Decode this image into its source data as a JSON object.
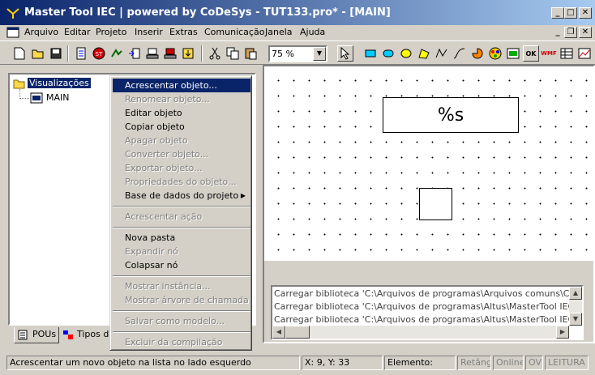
{
  "window": {
    "title": "Master Tool IEC | powered by CoDeSys - TUT133.pro* - [MAIN]",
    "minimize": "_",
    "maximize": "□",
    "close": "✕"
  },
  "menubar": {
    "items": [
      "Arquivo",
      "Editar",
      "Projeto",
      "Inserir",
      "Extras",
      "Comunicação",
      "Janela",
      "Ajuda"
    ],
    "mdi_min": "_",
    "mdi_restore": "❐",
    "mdi_close": "✕"
  },
  "toolbar": {
    "zoom_value": "75 %",
    "ok_label": "OK",
    "wmf_label": "WMF"
  },
  "tree": {
    "root_label": "Visualizações",
    "child_label": "MAIN"
  },
  "tabs": {
    "pous": "POUs",
    "tipos": "Tipos de"
  },
  "canvas": {
    "text_element": "%s"
  },
  "context_menu": {
    "items": [
      {
        "label": "Acrescentar objeto...",
        "state": "selected"
      },
      {
        "label": "Renomear objeto...",
        "state": "disabled"
      },
      {
        "label": "Editar objeto",
        "state": "enabled"
      },
      {
        "label": "Copiar objeto",
        "state": "enabled"
      },
      {
        "label": "Apagar objeto",
        "state": "disabled"
      },
      {
        "label": "Converter objeto...",
        "state": "disabled"
      },
      {
        "label": "Exportar objeto...",
        "state": "disabled"
      },
      {
        "label": "Propriedades do objeto...",
        "state": "disabled"
      },
      {
        "label": "Base de dados do projeto",
        "state": "enabled",
        "submenu": true
      },
      {
        "label": "Acrescentar ação",
        "state": "disabled"
      },
      {
        "label": "Nova pasta",
        "state": "enabled"
      },
      {
        "label": "Expandir nó",
        "state": "disabled"
      },
      {
        "label": "Colapsar nó",
        "state": "enabled"
      },
      {
        "label": "Mostrar instância...",
        "state": "disabled"
      },
      {
        "label": "Mostrar árvore de chamada",
        "state": "disabled"
      },
      {
        "label": "Salvar como modelo...",
        "state": "disabled"
      },
      {
        "label": "Excluir da compilação",
        "state": "disabled"
      }
    ],
    "submenu_arrow": "▶"
  },
  "messages": {
    "lines": [
      "Carregar biblioteca 'C:\\Arquivos de programas\\Arquivos comuns\\CA",
      "Carregar biblioteca 'C:\\Arquivos de programas\\Altus\\MasterTool IEC",
      "Carregar biblioteca 'C:\\Arquivos de programas\\Altus\\MasterTool IEC"
    ]
  },
  "statusbar": {
    "hint": "Acrescentar um novo objeto na lista no lado esquerdo",
    "coords": "X:    9, Y:    33",
    "element": "Elemento:",
    "retang": "Retâng",
    "online": "Online",
    "ov": "OV",
    "leitura": "LEITURA"
  },
  "colors": {
    "title_start": "#0a246a",
    "title_end": "#a6caf0",
    "selection": "#0a246a",
    "face": "#d4d0c8"
  }
}
